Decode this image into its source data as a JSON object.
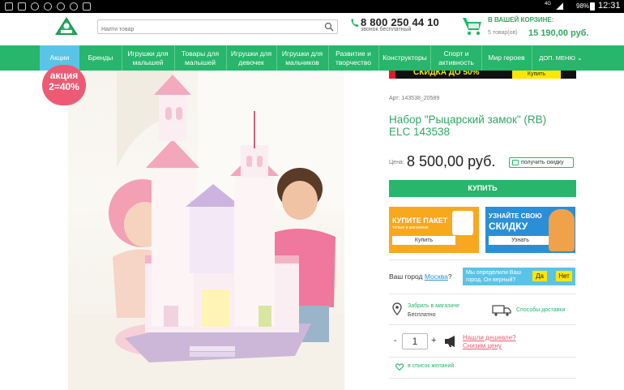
{
  "status_bar": {
    "network": "4G",
    "battery": "98%",
    "time": "12:31"
  },
  "header": {
    "search_placeholder": "Найти товар",
    "phone": "8 800 250 44 10",
    "phone_sub": "звонок бесплатный",
    "cart_title": "В ВАШЕЙ КОРЗИНЕ:",
    "cart_count": "5 товар(ов)",
    "cart_sum": "15 190,00 руб."
  },
  "nav": [
    {
      "label": "Акции"
    },
    {
      "label": "Бренды"
    },
    {
      "label": "Игрушки для малышей"
    },
    {
      "label": "Товары для малышей"
    },
    {
      "label": "Игрушки для девочек"
    },
    {
      "label": "Игрушки для мальчиков"
    },
    {
      "label": "Развитие и творчество"
    },
    {
      "label": "Конструкторы"
    },
    {
      "label": "Спорт и активность"
    },
    {
      "label": "Мир героев"
    },
    {
      "label": "ДОП. МЕНЮ"
    }
  ],
  "promo": {
    "line1": "акция",
    "line2": "2=40%"
  },
  "top_banner": {
    "text": "СКИДКА ДО 50%",
    "button": "Купить"
  },
  "product": {
    "article": "Арт: 143538_20589",
    "title_line1": "Набор \"Рыцарский замок\" (RB)",
    "title_line2": "ELC 143538",
    "price_label": "Цена:",
    "price": "8 500,00 руб.",
    "discount_btn": "получить скидку",
    "buy_btn": "КУПИТЬ"
  },
  "banners": {
    "left": {
      "title": "КУПИТЕ ПАКЕТ",
      "sub": "только в магазинах",
      "button": "Купить"
    },
    "right": {
      "line1": "УЗНАЙТЕ СВОЮ",
      "line2": "СКИДКУ",
      "button": "Узнать"
    }
  },
  "city": {
    "label": "Ваш город",
    "city": "Москва",
    "q": "?",
    "detect_line1": "Мы определили Ваш",
    "detect_line2": "город. Он верный?",
    "yes": "Да",
    "no": "Нет"
  },
  "delivery": {
    "pickup_link": "Забрать в магазине",
    "pickup_status": "Бесплатно",
    "methods": "Способы доставки"
  },
  "qty": {
    "minus": "-",
    "value": "1",
    "plus": "+"
  },
  "cheaper": {
    "line1": "Нашли дешевле?",
    "line2": "Снизим цену"
  },
  "wishlist": "в список желаний",
  "colors": {
    "green": "#27b66b",
    "pink": "#ee5a73",
    "blue": "#5ac4e8",
    "yellow": "#ffe600"
  }
}
